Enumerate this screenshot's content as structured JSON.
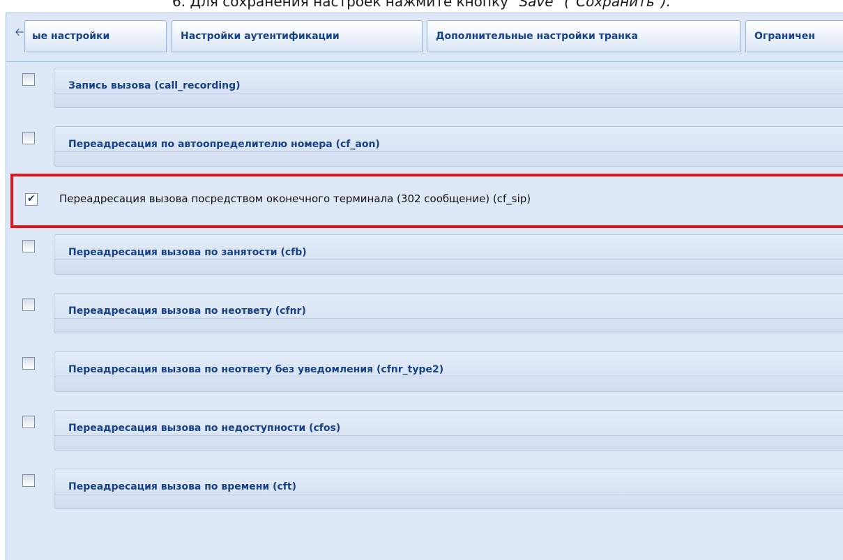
{
  "instruction": {
    "prefix": "6. Для сохранения настроек нажмите кнопку ",
    "save_word": "\"Save\" (\"Сохранить\").",
    "full": "6. Для сохранения настроек нажмите кнопку \"Save\" (\"Сохранить\")."
  },
  "tabs": [
    {
      "label": "ые настройки"
    },
    {
      "label": "Настройки аутентификации"
    },
    {
      "label": "Дополнительные настройки транка"
    },
    {
      "label": "Ограничен"
    }
  ],
  "services": [
    {
      "label": "Запись вызова (call_recording)",
      "checked": false
    },
    {
      "label": "Переадресация по автоопределителю номера (cf_aon)",
      "checked": false
    },
    {
      "label": "Переадресация вызова посредством оконечного терминала (302 сообщение) (cf_sip)",
      "checked": true
    },
    {
      "label": "Переадресация вызова по занятости (cfb)",
      "checked": false
    },
    {
      "label": "Переадресация вызова по неответу (cfnr)",
      "checked": false
    },
    {
      "label": "Переадресация вызова по неответу без уведомления (cfnr_type2)",
      "checked": false
    },
    {
      "label": "Переадресация вызова по недоступности (cfos)",
      "checked": false
    },
    {
      "label": "Переадресация вызова по времени (cft)",
      "checked": false
    }
  ],
  "highlight_color": "#e8141c",
  "accent_color": "#15428b"
}
